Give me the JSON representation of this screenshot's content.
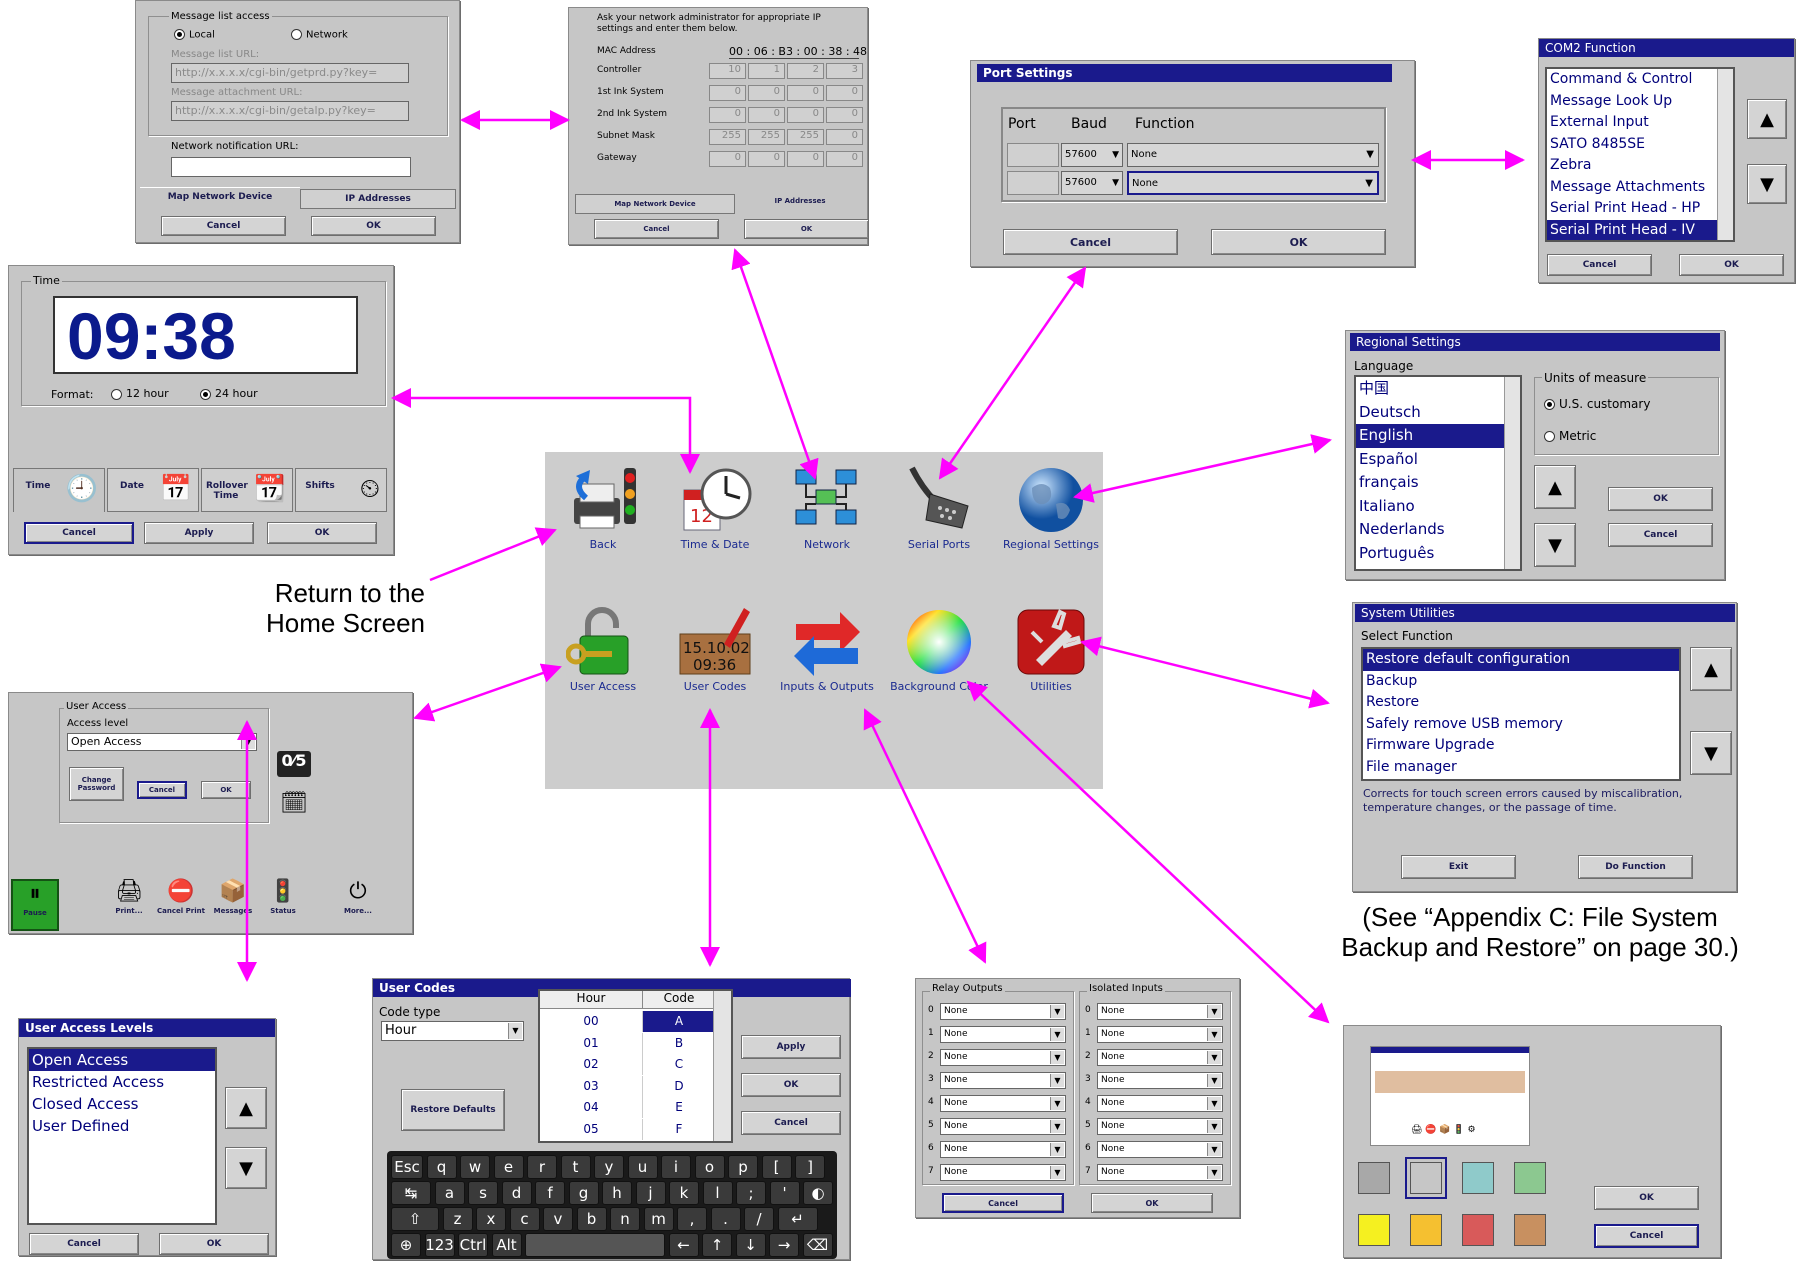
{
  "return_label": "Return to the\nHome Screen",
  "appendix_note": "(See “Appendix C: File System\nBackup and Restore” on page 30.)",
  "colors": {
    "accent": "#ff00ff",
    "title_bar": "#1a1a8c",
    "panel": "#c6c6c6"
  },
  "home": {
    "icons": [
      {
        "label": "Back",
        "icon": "back-icon"
      },
      {
        "label": "Time & Date",
        "icon": "clock-calendar-icon"
      },
      {
        "label": "Network",
        "icon": "network-icon"
      },
      {
        "label": "Serial Ports",
        "icon": "serial-cable-icon"
      },
      {
        "label": "Regional Settings",
        "icon": "globe-icon"
      },
      {
        "label": "User Access",
        "icon": "padlock-key-icon"
      },
      {
        "label": "User Codes",
        "icon": "user-codes-icon"
      },
      {
        "label": "Inputs & Outputs",
        "icon": "arrows-icon"
      },
      {
        "label": "Background Color",
        "icon": "color-wheel-icon"
      },
      {
        "label": "Utilities",
        "icon": "swiss-knife-icon"
      }
    ],
    "user_codes_icon_text": [
      "15.10.02",
      "09:36"
    ]
  },
  "message_list": {
    "group": "Message list access",
    "local": "Local",
    "network": "Network",
    "list_url_label": "Message list URL:",
    "list_url": "http://x.x.x.x/cgi-bin/getprd.py?key=",
    "attach_url_label": "Message attachment URL:",
    "attach_url": "http://x.x.x.x/cgi-bin/getalp.py?key=",
    "notify_label": "Network notification URL:",
    "tab1": "Map Network Device",
    "tab2": "IP Addresses",
    "cancel": "Cancel",
    "ok": "OK"
  },
  "ip": {
    "intro": "Ask your network administrator for appropriate IP settings and enter them below.",
    "mac_label": "MAC Address",
    "mac": "00 : 06 : B3 : 00 : 38 : 48",
    "rows": [
      {
        "label": "Controller",
        "v": [
          "10",
          "1",
          "2",
          "3"
        ]
      },
      {
        "label": "1st Ink System",
        "v": [
          "0",
          "0",
          "0",
          "0"
        ]
      },
      {
        "label": "2nd Ink System",
        "v": [
          "0",
          "0",
          "0",
          "0"
        ]
      },
      {
        "label": "Subnet Mask",
        "v": [
          "255",
          "255",
          "255",
          "0"
        ]
      },
      {
        "label": "Gateway",
        "v": [
          "0",
          "0",
          "0",
          "0"
        ]
      }
    ],
    "tab1": "Map Network Device",
    "tab2": "IP Addresses",
    "cancel": "Cancel",
    "ok": "OK"
  },
  "port": {
    "title": "Port Settings",
    "h_port": "Port",
    "h_baud": "Baud",
    "h_func": "Function",
    "rows": [
      {
        "baud": "57600",
        "func": "None"
      },
      {
        "baud": "57600",
        "func": "None"
      }
    ],
    "cancel": "Cancel",
    "ok": "OK"
  },
  "com2": {
    "title": "COM2 Function",
    "items": [
      "Command & Control",
      "Message Look Up",
      "External Input",
      "SATO 8485SE",
      "Zebra",
      "Message Attachments",
      "Serial Print Head - HP",
      "Serial Print Head - IV"
    ],
    "selected": 7,
    "cancel": "Cancel",
    "ok": "OK"
  },
  "time": {
    "group": "Time",
    "clock": "09:38",
    "format_label": "Format:",
    "h12": "12 hour",
    "h24": "24 hour",
    "tabs": [
      "Time",
      "Date",
      "Rollover Time",
      "Shifts"
    ],
    "cancel": "Cancel",
    "apply": "Apply",
    "ok": "OK"
  },
  "regional": {
    "title": "Regional Settings",
    "lang_label": "Language",
    "langs": [
      "中国",
      "Deutsch",
      "English",
      "Español",
      "français",
      "Italiano",
      "Nederlands",
      "Português"
    ],
    "selected": 2,
    "units_label": "Units of measure",
    "us": "U.S. customary",
    "metric": "Metric",
    "ok": "OK",
    "cancel": "Cancel"
  },
  "utilities": {
    "title": "System Utilities",
    "select_label": "Select Function",
    "items": [
      "Restore default configuration",
      "Backup",
      "Restore",
      "Safely remove USB memory",
      "Firmware Upgrade",
      "File manager"
    ],
    "selected": 0,
    "desc": "Corrects for touch screen errors caused by miscalibration, temperature changes, or the passage of time.",
    "exit": "Exit",
    "do": "Do Function"
  },
  "user_access": {
    "group": "User Access",
    "level_label": "Access level",
    "level": "Open Access",
    "change_pw": "Change Password",
    "cancel": "Cancel",
    "ok": "OK",
    "toolbar": [
      "Pause",
      "Print...",
      "Cancel Print",
      "Messages",
      "Status",
      "More..."
    ]
  },
  "levels": {
    "title": "User Access Levels",
    "items": [
      "Open Access",
      "Restricted Access",
      "Closed Access",
      "User Defined"
    ],
    "selected": 0,
    "cancel": "Cancel",
    "ok": "OK"
  },
  "user_codes": {
    "title": "User Codes",
    "code_type_label": "Code type",
    "code_type": "Hour",
    "restore": "Restore Defaults",
    "h_hour": "Hour",
    "h_code": "Code",
    "rows": [
      [
        "00",
        "A"
      ],
      [
        "01",
        "B"
      ],
      [
        "02",
        "C"
      ],
      [
        "03",
        "D"
      ],
      [
        "04",
        "E"
      ],
      [
        "05",
        "F"
      ]
    ],
    "apply": "Apply",
    "ok": "OK",
    "cancel": "Cancel",
    "kb": [
      [
        "Esc",
        "q",
        "w",
        "e",
        "r",
        "t",
        "y",
        "u",
        "i",
        "o",
        "p",
        "[",
        "]"
      ],
      [
        "↹",
        "a",
        "s",
        "d",
        "f",
        "g",
        "h",
        "j",
        "k",
        "l",
        ";",
        "'",
        "◐"
      ],
      [
        "⇧",
        "z",
        "x",
        "c",
        "v",
        "b",
        "n",
        "m",
        ",",
        ".",
        "/",
        "↵"
      ],
      [
        "⊕",
        "123",
        "Ctrl",
        "Alt",
        "",
        "←",
        "↑",
        "↓",
        "→",
        "⌫"
      ]
    ]
  },
  "io": {
    "relay_label": "Relay Outputs",
    "iso_label": "Isolated Inputs",
    "nums": [
      "0",
      "1",
      "2",
      "3",
      "4",
      "5",
      "6",
      "7"
    ],
    "value": "None",
    "cancel": "Cancel",
    "ok": "OK"
  },
  "bgcolor": {
    "ok": "OK",
    "cancel": "Cancel",
    "swatches": [
      "#a8a8a8",
      "#c6c6c6",
      "#8fcaca",
      "#8cc890",
      "#f5f020",
      "#f5c030",
      "#d85a5a",
      "#c89060"
    ]
  }
}
